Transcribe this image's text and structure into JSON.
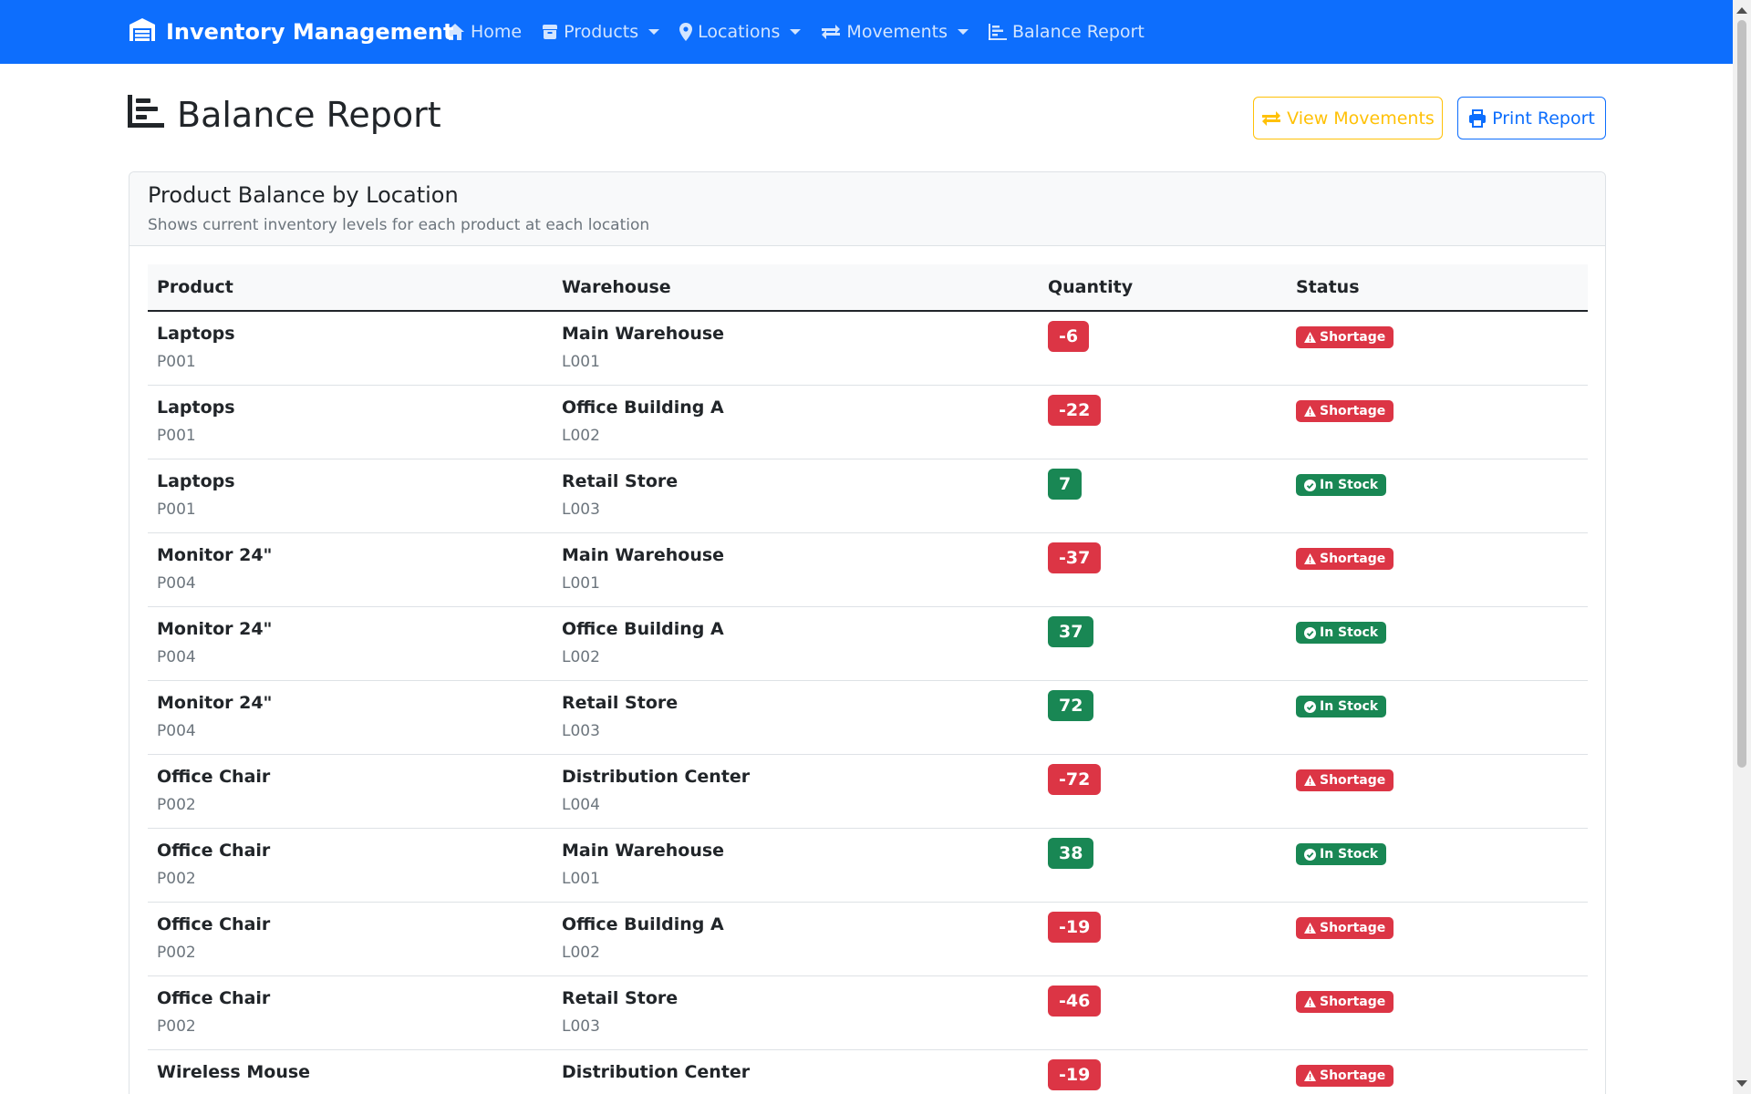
{
  "nav": {
    "brand": "Inventory Management",
    "items": [
      {
        "label": "Home",
        "icon": "home-icon",
        "dropdown": false
      },
      {
        "label": "Products",
        "icon": "box-icon",
        "dropdown": true
      },
      {
        "label": "Locations",
        "icon": "map-pin-icon",
        "dropdown": true
      },
      {
        "label": "Movements",
        "icon": "exchange-icon",
        "dropdown": true
      },
      {
        "label": "Balance Report",
        "icon": "chart-bar-icon",
        "dropdown": false
      }
    ]
  },
  "page": {
    "title": "Balance Report",
    "view_movements": "View Movements",
    "print_report": "Print Report"
  },
  "card": {
    "title": "Product Balance by Location",
    "subtitle": "Shows current inventory levels for each product at each location"
  },
  "table": {
    "headers": [
      "Product",
      "Warehouse",
      "Quantity",
      "Status"
    ],
    "rows": [
      {
        "product": "Laptops",
        "product_code": "P001",
        "warehouse": "Main Warehouse",
        "warehouse_code": "L001",
        "quantity": "-6",
        "status": "Shortage"
      },
      {
        "product": "Laptops",
        "product_code": "P001",
        "warehouse": "Office Building A",
        "warehouse_code": "L002",
        "quantity": "-22",
        "status": "Shortage"
      },
      {
        "product": "Laptops",
        "product_code": "P001",
        "warehouse": "Retail Store",
        "warehouse_code": "L003",
        "quantity": "7",
        "status": "In Stock"
      },
      {
        "product": "Monitor 24\"",
        "product_code": "P004",
        "warehouse": "Main Warehouse",
        "warehouse_code": "L001",
        "quantity": "-37",
        "status": "Shortage"
      },
      {
        "product": "Monitor 24\"",
        "product_code": "P004",
        "warehouse": "Office Building A",
        "warehouse_code": "L002",
        "quantity": "37",
        "status": "In Stock"
      },
      {
        "product": "Monitor 24\"",
        "product_code": "P004",
        "warehouse": "Retail Store",
        "warehouse_code": "L003",
        "quantity": "72",
        "status": "In Stock"
      },
      {
        "product": "Office Chair",
        "product_code": "P002",
        "warehouse": "Distribution Center",
        "warehouse_code": "L004",
        "quantity": "-72",
        "status": "Shortage"
      },
      {
        "product": "Office Chair",
        "product_code": "P002",
        "warehouse": "Main Warehouse",
        "warehouse_code": "L001",
        "quantity": "38",
        "status": "In Stock"
      },
      {
        "product": "Office Chair",
        "product_code": "P002",
        "warehouse": "Office Building A",
        "warehouse_code": "L002",
        "quantity": "-19",
        "status": "Shortage"
      },
      {
        "product": "Office Chair",
        "product_code": "P002",
        "warehouse": "Retail Store",
        "warehouse_code": "L003",
        "quantity": "-46",
        "status": "Shortage"
      },
      {
        "product": "Wireless Mouse",
        "product_code": "",
        "warehouse": "Distribution Center",
        "warehouse_code": "",
        "quantity": "-19",
        "status": "Shortage"
      }
    ]
  },
  "colors": {
    "primary": "#0d6efd",
    "warning": "#ffc107",
    "danger": "#dc3545",
    "success": "#198754"
  }
}
